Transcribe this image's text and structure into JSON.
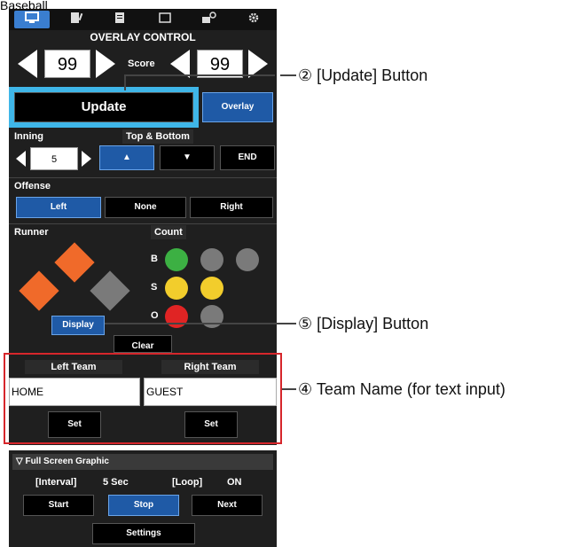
{
  "caption": "Baseball",
  "tabs": [
    {
      "icon": "monitor-icon"
    },
    {
      "icon": "document-edit-icon"
    },
    {
      "icon": "document-list-icon"
    },
    {
      "icon": "window-icon"
    },
    {
      "icon": "camera-settings-icon"
    },
    {
      "icon": "gear-icon"
    }
  ],
  "overlay": {
    "title": "OVERLAY CONTROL",
    "score_label": "Score",
    "score_left": "99",
    "score_right": "99",
    "update_label": "Update",
    "overlay_label": "Overlay",
    "inning_label": "Inning",
    "inning_value": "5",
    "top_bottom_label": "Top & Bottom",
    "top_label": "▲",
    "bottom_label": "▼",
    "end_label": "END",
    "offense_label": "Offense",
    "offense_left": "Left",
    "offense_none": "None",
    "offense_right": "Right",
    "runner_label": "Runner",
    "count_label": "Count",
    "b_label": "B",
    "s_label": "S",
    "o_label": "O",
    "display_label": "Display",
    "clear_label": "Clear"
  },
  "teams": {
    "left_label": "Left Team",
    "right_label": "Right Team",
    "left_value": "HOME",
    "right_value": "GUEST",
    "set_label": "Set"
  },
  "fullscreen": {
    "header": "▽ Full Screen Graphic",
    "interval_label": "[Interval]",
    "interval_value": "5 Sec",
    "loop_label": "[Loop]",
    "loop_value": "ON",
    "start_label": "Start",
    "stop_label": "Stop",
    "next_label": "Next",
    "settings_label": "Settings"
  },
  "callouts": {
    "update": "② [Update] Button",
    "display": "⑤ [Display] Button",
    "team": "④ Team Name (for text input)"
  },
  "colors": {
    "highlight_blue": "#3fb6e8",
    "annotation_red": "#d6262b",
    "ball_green": "#3cb043",
    "strike_yellow": "#f2cd2c",
    "out_red": "#e02424",
    "runner_orange": "#f06a2a",
    "inactive_gray": "#7a7a7a"
  }
}
